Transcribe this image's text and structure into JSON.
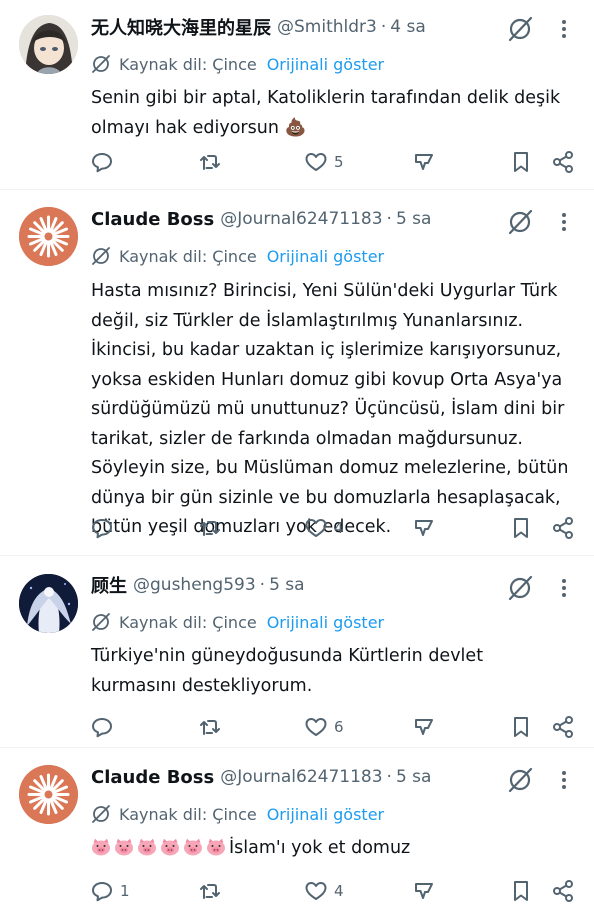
{
  "posts": [
    {
      "name": "无人知晓大海里的星辰",
      "handle": "@Smithldr3",
      "time": "4 sa",
      "translation": {
        "source_label": "Kaynak dil: Çince",
        "show_original": "Orijinali göster"
      },
      "text": "Senin gibi bir aptal, Katoliklerin tarafından delik deşik olmayı hak ediyorsun 💩",
      "likes": "5",
      "replies": ""
    },
    {
      "name": "Claude Boss",
      "handle": "@Journal62471183",
      "time": "5 sa",
      "translation": {
        "source_label": "Kaynak dil: Çince",
        "show_original": "Orijinali göster"
      },
      "text": "Hasta mısınız? Birincisi, Yeni Sülün'deki Uygurlar Türk değil, siz Türkler de İslamlaştırılmış Yunanlarsınız. İkincisi, bu kadar uzaktan iç işlerimize karışıyorsunuz, yoksa eskiden Hunları domuz gibi kovup Orta Asya'ya sürdüğümüzü mü unuttunuz? Üçüncüsü, İslam dini bir tarikat, sizler de farkında olmadan mağdursunuz. Söyleyin size, bu Müslüman domuz melezlerine, bütün dünya bir gün sizinle ve bu domuzlarla hesaplaşacak, bütün yeşil domuzları yok edecek.",
      "likes": "4",
      "replies": ""
    },
    {
      "name": "顾生",
      "handle": "@gusheng593",
      "time": "5 sa",
      "translation": {
        "source_label": "Kaynak dil: Çince",
        "show_original": "Orijinali göster"
      },
      "text": "Türkiye'nin güneydoğusunda Kürtlerin devlet kurmasını destekliyorum.",
      "likes": "6",
      "replies": ""
    },
    {
      "name": "Claude Boss",
      "handle": "@Journal62471183",
      "time": "5 sa",
      "translation": {
        "source_label": "Kaynak dil: Çince",
        "show_original": "Orijinali göster"
      },
      "text": "İslam'ı yok et domuz",
      "likes": "4",
      "replies": "1"
    }
  ],
  "colors": {
    "text": "#0f1419",
    "secondary": "#536471",
    "link": "#1d9bf0",
    "divider": "#eff3f4",
    "claude_orange": "#d97757"
  },
  "icons": [
    "grok-icon",
    "more-icon",
    "translate-icon",
    "reply-icon",
    "retweet-icon",
    "like-icon",
    "stats-icon",
    "bookmark-icon",
    "share-icon",
    "poo-emoji",
    "pig-emoji"
  ]
}
